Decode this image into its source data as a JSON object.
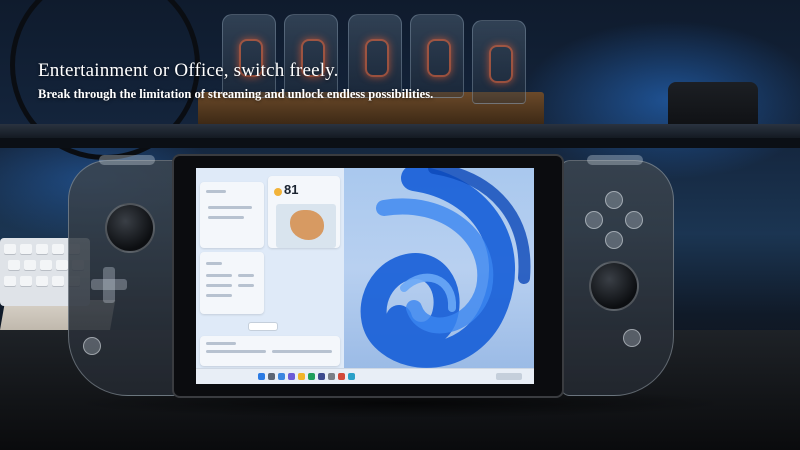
{
  "headline": "Entertainment or Office, switch freely.",
  "subheadline": "Break through the limitation of streaming and unlock endless possibilities.",
  "device_screen": {
    "weather_temp": "81",
    "wallpaper": "windows-11-bloom",
    "accent_color": "#1d63d8"
  }
}
